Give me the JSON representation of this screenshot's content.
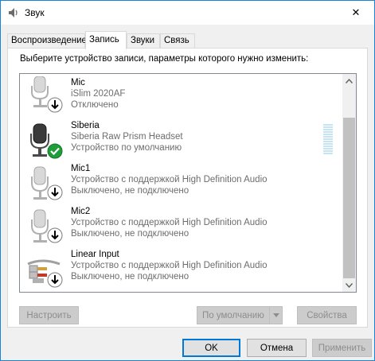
{
  "window": {
    "title": "Звук",
    "close_glyph": "✕"
  },
  "tabs": [
    {
      "label": "Воспроизведение",
      "active": false
    },
    {
      "label": "Запись",
      "active": true
    },
    {
      "label": "Звуки",
      "active": false
    },
    {
      "label": "Связь",
      "active": false
    }
  ],
  "panel": {
    "instruction": "Выберите устройство записи, параметры которого нужно изменить:"
  },
  "devices": [
    {
      "name": "Mic",
      "description": "iSlim 2020AF",
      "status": "Отключено",
      "icon": "microphone-icon",
      "badge": "down-arrow-badge-icon"
    },
    {
      "name": "Siberia",
      "description": "Siberia Raw Prism Headset",
      "status": "Устройство по умолчанию",
      "icon": "headset-microphone-icon",
      "badge": "default-check-badge-icon"
    },
    {
      "name": "Mic1",
      "description": "Устройство с поддержкой High Definition Audio",
      "status": "Выключено, не подключено",
      "icon": "microphone-icon",
      "badge": "down-arrow-badge-icon"
    },
    {
      "name": "Mic2",
      "description": "Устройство с поддержкой High Definition Audio",
      "status": "Выключено, не подключено",
      "icon": "microphone-icon",
      "badge": "down-arrow-badge-icon"
    },
    {
      "name": "Linear Input",
      "description": "Устройство с поддержкой High Definition Audio",
      "status": "Выключено, не подключено",
      "icon": "line-in-cable-icon",
      "badge": "down-arrow-badge-icon"
    }
  ],
  "buttons": {
    "configure": "Настроить",
    "set_default": "По умолчанию",
    "properties": "Свойства",
    "ok": "OK",
    "cancel": "Отмена",
    "apply": "Применить"
  },
  "colors": {
    "accent": "#0078d7",
    "check_green": "#1f9d3a",
    "scrollbar_thumb": "#c1c1c1",
    "level_meter": "#c6e4f2"
  }
}
